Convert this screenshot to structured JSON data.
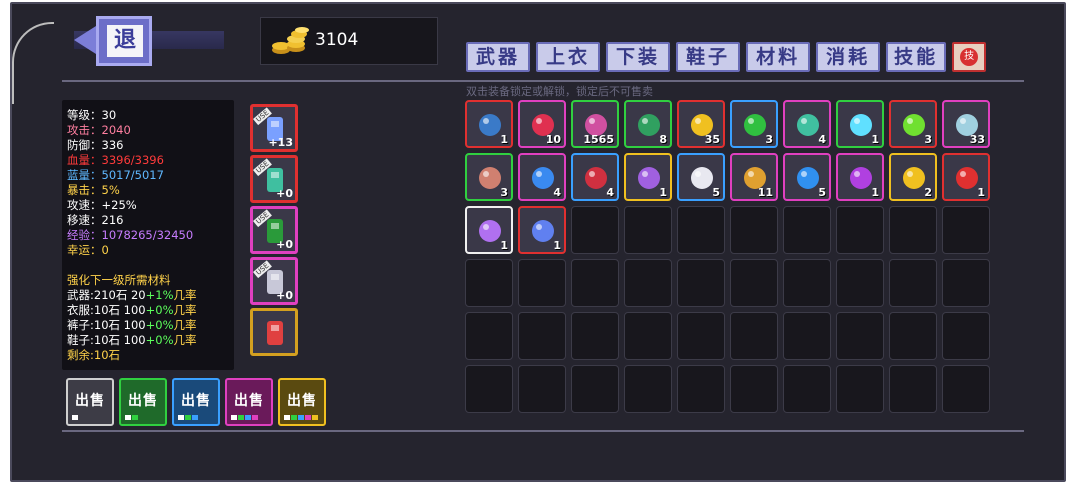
{
  "header": {
    "back_label": "退",
    "gold_amount": "3104"
  },
  "tabs": [
    {
      "label": "武器"
    },
    {
      "label": "上衣"
    },
    {
      "label": "下装"
    },
    {
      "label": "鞋子"
    },
    {
      "label": "材料"
    },
    {
      "label": "消耗"
    },
    {
      "label": "技能"
    }
  ],
  "refresh_label": "技",
  "hint": "双击装备锁定或解锁，锁定后不可售卖",
  "stats": [
    {
      "label": "等级",
      "value": "30",
      "color": "#ffffff"
    },
    {
      "label": "攻击",
      "value": "2040",
      "color": "#ff7fa0"
    },
    {
      "label": "防御",
      "value": "336",
      "color": "#ffffff"
    },
    {
      "label": "血量",
      "value": "3396/3396",
      "color": "#ff3b3b"
    },
    {
      "label": "蓝量",
      "value": "5017/5017",
      "color": "#5fb8ff"
    },
    {
      "label": "暴击",
      "value": "5%",
      "color": "#ffd24a"
    },
    {
      "label": "攻速",
      "value": "+25%",
      "color": "#ffffff"
    },
    {
      "label": "移速",
      "value": "216",
      "color": "#ffffff"
    },
    {
      "label": "经验",
      "value": "1078265/32450",
      "color": "#c77dff"
    },
    {
      "label": "幸运",
      "value": "0",
      "color": "#ffd24a"
    }
  ],
  "upgrade": {
    "title": "强化下一级所需材料",
    "lines": [
      {
        "prefix": "武器:210石 20",
        "bonus": "+1%",
        "suffix": "几率"
      },
      {
        "prefix": "衣服:10石 100",
        "bonus": "+0%",
        "suffix": "几率"
      },
      {
        "prefix": "裤子:10石 100",
        "bonus": "+0%",
        "suffix": "几率"
      },
      {
        "prefix": "鞋子:10石 100",
        "bonus": "+0%",
        "suffix": "几率"
      }
    ],
    "remaining": "剩余:10石"
  },
  "equipment": [
    {
      "tag": "USE",
      "level": "+13",
      "color": "#e03030",
      "icon": "sword-icon",
      "art": "#7aa0ff"
    },
    {
      "tag": "USE",
      "level": "+0",
      "color": "#e03030",
      "icon": "robe-icon",
      "art": "#3fbfa0"
    },
    {
      "tag": "USE",
      "level": "+0",
      "color": "#e040c0",
      "icon": "pants-icon",
      "art": "#2a9a3a"
    },
    {
      "tag": "USE",
      "level": "+0",
      "color": "#e040c0",
      "icon": "shoes-icon",
      "art": "#c8c8d8"
    },
    {
      "tag": "",
      "level": "",
      "color": "#d4a020",
      "icon": "pet-icon",
      "art": "#e04040"
    }
  ],
  "sell_buttons": [
    {
      "label": "出售",
      "border": "#cfcfcf",
      "bg": "#3d3c46",
      "squares": [
        "#ffffff"
      ]
    },
    {
      "label": "出售",
      "border": "#30d040",
      "bg": "#1f6a2a",
      "squares": [
        "#ffffff",
        "#30d040"
      ]
    },
    {
      "label": "出售",
      "border": "#3aa0ff",
      "bg": "#1a4a7a",
      "squares": [
        "#ffffff",
        "#30d040",
        "#3aa0ff"
      ]
    },
    {
      "label": "出售",
      "border": "#e040c0",
      "bg": "#6a1a5a",
      "squares": [
        "#ffffff",
        "#30d040",
        "#3aa0ff",
        "#e040c0"
      ]
    },
    {
      "label": "出售",
      "border": "#f0c020",
      "bg": "#5a4a10",
      "squares": [
        "#ffffff",
        "#30d040",
        "#3aa0ff",
        "#e040c0",
        "#f0c020"
      ]
    }
  ],
  "inventory": [
    {
      "count": "1",
      "border": "#e03030",
      "icon": "book-icon",
      "art": "#3a7ac8"
    },
    {
      "count": "10",
      "border": "#e040c0",
      "icon": "crystal-icon",
      "art": "#e03050"
    },
    {
      "count": "1565",
      "border": "#30d040",
      "icon": "pillar-icon",
      "art": "#d050a0"
    },
    {
      "count": "8",
      "border": "#30d040",
      "icon": "herb-icon",
      "art": "#30a060"
    },
    {
      "count": "35",
      "border": "#e03030",
      "icon": "key-icon",
      "art": "#f0c020"
    },
    {
      "count": "3",
      "border": "#3aa0ff",
      "icon": "slime-icon",
      "art": "#30c040"
    },
    {
      "count": "4",
      "border": "#e040c0",
      "icon": "fish-icon",
      "art": "#40c0a0"
    },
    {
      "count": "1",
      "border": "#30d040",
      "icon": "spark-icon",
      "art": "#60e0ff"
    },
    {
      "count": "3",
      "border": "#e03030",
      "icon": "orb-icon",
      "art": "#70e030"
    },
    {
      "count": "33",
      "border": "#e040c0",
      "icon": "potion-icon",
      "art": "#a0d0e0"
    },
    {
      "count": "3",
      "border": "#30d040",
      "icon": "octopus-icon",
      "art": "#d08070"
    },
    {
      "count": "4",
      "border": "#e040c0",
      "icon": "amulet-icon",
      "art": "#3a8af0"
    },
    {
      "count": "4",
      "border": "#3aa0ff",
      "icon": "heart-icon",
      "art": "#d03040"
    },
    {
      "count": "1",
      "border": "#f0c020",
      "icon": "gem-cluster-icon",
      "art": "#a060e0"
    },
    {
      "count": "5",
      "border": "#3aa0ff",
      "icon": "egg-icon",
      "art": "#e8e8f0"
    },
    {
      "count": "11",
      "border": "#e040c0",
      "icon": "bread-icon",
      "art": "#e0a030"
    },
    {
      "count": "5",
      "border": "#e040c0",
      "icon": "sphere-icon",
      "art": "#3090f0"
    },
    {
      "count": "1",
      "border": "#e040c0",
      "icon": "purple-egg-icon",
      "art": "#b040e0"
    },
    {
      "count": "2",
      "border": "#f0c020",
      "icon": "gold-gem-icon",
      "art": "#f0c020"
    },
    {
      "count": "1",
      "border": "#e03030",
      "icon": "red-beetle-icon",
      "art": "#e03030"
    },
    {
      "count": "1",
      "border": "#f0f0f0",
      "icon": "ice-crystal-icon",
      "art": "#b070f0"
    },
    {
      "count": "1",
      "border": "#e03030",
      "icon": "gems-icon",
      "art": "#6080f0"
    }
  ]
}
